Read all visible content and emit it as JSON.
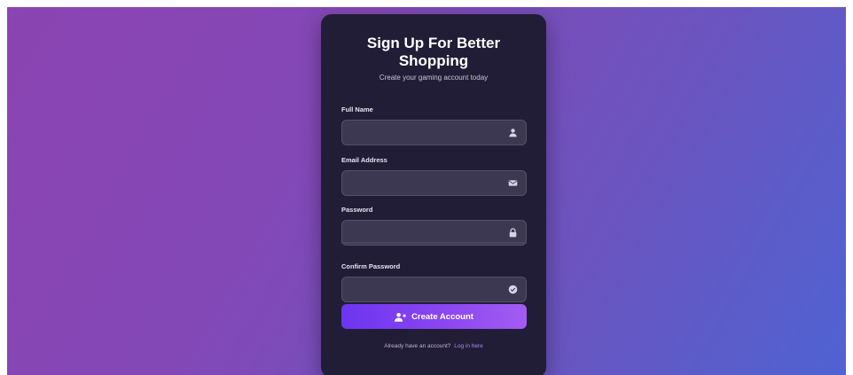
{
  "form": {
    "title": "Sign Up For Better Shopping",
    "subtitle": "Create your gaming account today",
    "fields": [
      {
        "label": "Full Name",
        "value": "",
        "placeholder": "",
        "icon": "user-icon"
      },
      {
        "label": "Email Address",
        "value": "",
        "placeholder": "",
        "icon": "envelope-icon"
      },
      {
        "label": "Password",
        "value": "",
        "placeholder": "",
        "icon": "lock-icon"
      },
      {
        "label": "Confirm Password",
        "value": "",
        "placeholder": "",
        "icon": "check-circle-icon"
      }
    ],
    "submit_label": "Create Account",
    "submit_icon": "user-plus-icon",
    "footer_text": "Already have an account?",
    "login_link": "Log in here"
  },
  "colors": {
    "background_start": "#8b44b2",
    "background_end": "#4f63d2",
    "card": "#221d36",
    "input": "#3d3851",
    "accent": "#7c3aed",
    "link": "#a88bff"
  }
}
